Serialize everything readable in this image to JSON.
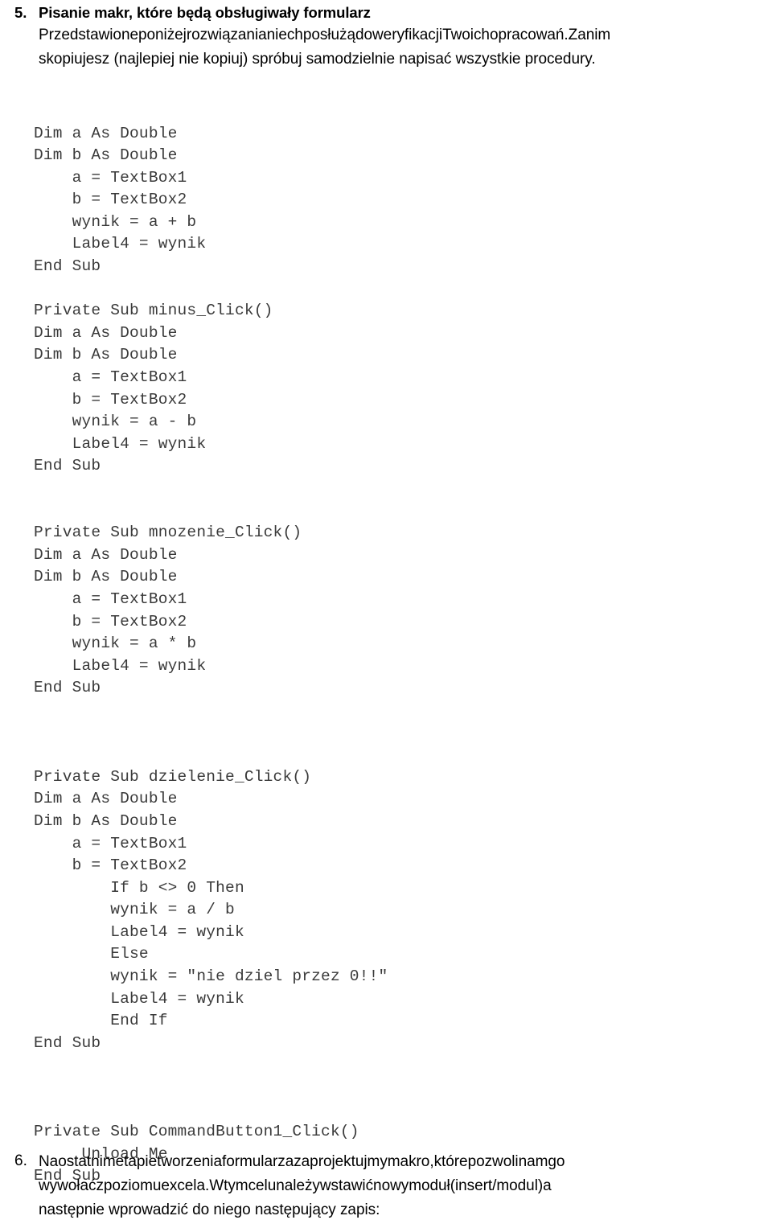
{
  "document": {
    "language": "pl",
    "background_color": "#ffffff",
    "text_color": "#000000",
    "code_color": "#3a3a3a"
  },
  "item5": {
    "marker": "5.",
    "heading": "Pisanie makr, które będą obsługiwały formularz",
    "body_lines": [
      {
        "justified": true,
        "words": [
          "Przedstawione",
          "poniżej",
          "rozwiązania",
          "niech",
          "posłużą",
          "do",
          "weryfikacji",
          "Twoich",
          "opracowań.",
          "Zanim"
        ]
      },
      {
        "justified": false,
        "words": [
          "skopiujesz (najlepiej nie kopiuj) spróbuj samodzielnie napisać wszystkie procedury."
        ]
      }
    ],
    "body_text": "Przedstawione poniżej rozwiązania niech posłużą do weryfikacji Twoich opracowań. Zanim skopiujesz (najlepiej nie kopiuj) spróbuj samodzielnie napisać wszystkie procedury."
  },
  "code": {
    "language": "vba",
    "lines": [
      "Dim a As Double",
      "Dim b As Double",
      "    a = TextBox1",
      "    b = TextBox2",
      "    wynik = a + b",
      "    Label4 = wynik",
      "End Sub",
      "",
      "Private Sub minus_Click()",
      "Dim a As Double",
      "Dim b As Double",
      "    a = TextBox1",
      "    b = TextBox2",
      "    wynik = a - b",
      "    Label4 = wynik",
      "End Sub",
      "",
      "",
      "Private Sub mnozenie_Click()",
      "Dim a As Double",
      "Dim b As Double",
      "    a = TextBox1",
      "    b = TextBox2",
      "    wynik = a * b",
      "    Label4 = wynik",
      "End Sub",
      "",
      "",
      "",
      "Private Sub dzielenie_Click()",
      "Dim a As Double",
      "Dim b As Double",
      "    a = TextBox1",
      "    b = TextBox2",
      "        If b <> 0 Then",
      "        wynik = a / b",
      "        Label4 = wynik",
      "        Else",
      "        wynik = \"nie dziel przez 0!!\"",
      "        Label4 = wynik",
      "        End If",
      "End Sub",
      "",
      "",
      "",
      "Private Sub CommandButton1_Click()",
      "     Unload Me",
      "End Sub"
    ]
  },
  "item6": {
    "marker": "6.",
    "body_lines": [
      {
        "justified": true,
        "words": [
          "Na",
          "ostatnim",
          "etapie",
          "tworzenia",
          "formularza",
          "zaprojektujmy",
          "makro,",
          "które",
          "pozwoli",
          "nam",
          "go"
        ]
      },
      {
        "justified": true,
        "words": [
          "wywołać",
          "z",
          "poziomu",
          "excela.",
          "W",
          "tym",
          "celu",
          "należy",
          "wstawić",
          "nowy",
          "moduł",
          "(insert/modul)",
          "a"
        ]
      },
      {
        "justified": false,
        "words": [
          "następnie wprowadzić do niego następujący zapis:"
        ]
      }
    ],
    "body_text": "Na ostatnim etapie tworzenia formularza zaprojektujmy makro, które pozwoli nam go wywołać z poziomu excela. W tym celu należy wstawić nowy moduł (insert/modul) a następnie wprowadzić do niego następujący zapis:"
  }
}
